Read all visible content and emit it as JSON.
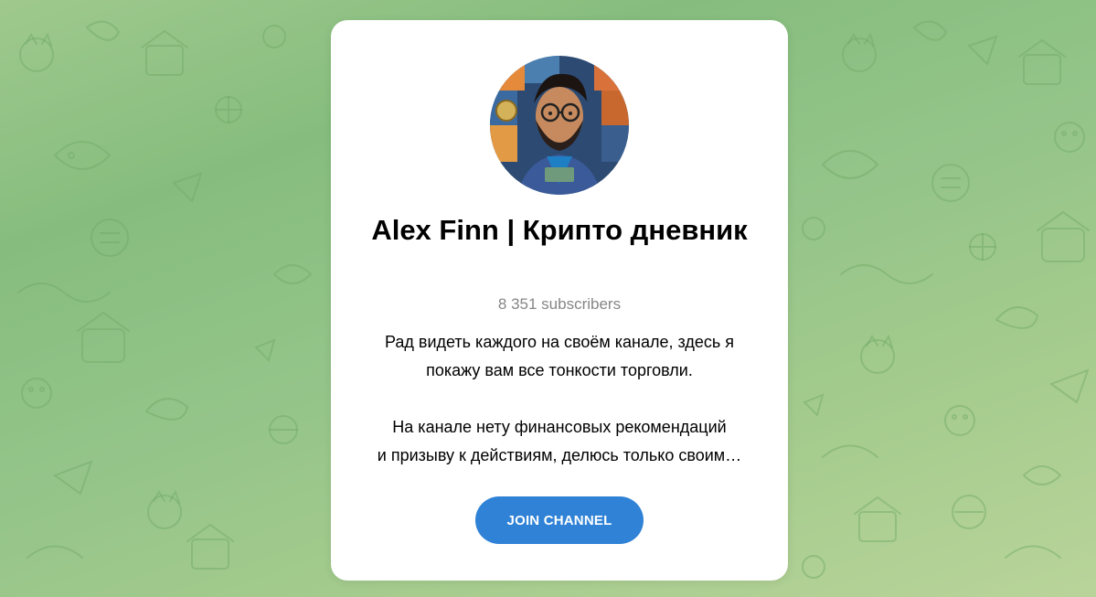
{
  "channel": {
    "title": "Alex Finn | Крипто дневник",
    "subscribers": "8 351 subscribers",
    "description_lines": [
      "Рад видеть каждого на своём канале, здесь я",
      "покажу вам все тонкости торговли.",
      "На канале нету финансовых рекомендаций",
      "и призыву к действиям, делюсь только своим…"
    ],
    "join_label": "JOIN CHANNEL"
  },
  "colors": {
    "accent": "#2f82d6",
    "background_green": "#94c489",
    "card": "#ffffff",
    "muted_text": "#868686"
  },
  "icons": {
    "avatar": "avatar-illustration-icon",
    "pattern": "doodle-pattern-icon"
  }
}
